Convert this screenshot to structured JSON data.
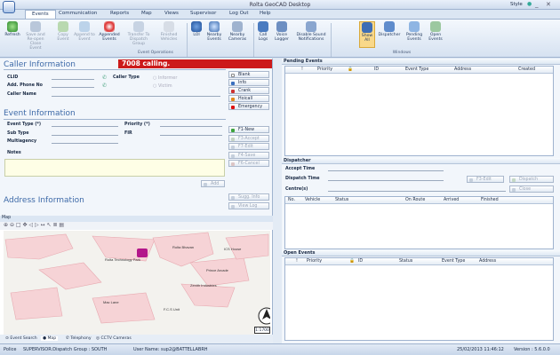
{
  "window": {
    "title": "Rolta GeoCAD Desktop",
    "style_label": "Style",
    "min": "_",
    "close": "✕"
  },
  "menu": [
    "Events",
    "Communication",
    "Reports",
    "Map",
    "Views",
    "Supervisor",
    "Log Out",
    "Help"
  ],
  "ribbon": {
    "buttons": [
      "Refresh",
      "Save and Re-open Close Event",
      "Copy Event",
      "Append to Event",
      "Appended Events",
      "Transfer To Dispatch Group",
      "Finished Vehicles",
      "LOI",
      "Nearby Events",
      "Nearby Cameras",
      "Call Logs",
      "Voice Logger",
      "Disable Sound Notifications",
      "Show All",
      "Dispatcher",
      "Pending Events",
      "Open Events"
    ],
    "groups": {
      "event_operations": "Event Operations",
      "windows": "Windows"
    }
  },
  "caller": {
    "heading": "Caller Information",
    "alert": "7008 calling.",
    "labels": {
      "clid": "CLID",
      "caller_type": "Caller Type",
      "add_phone": "Add. Phone No",
      "caller_name": "Caller Name"
    },
    "options": [
      "Informer",
      "Victim"
    ]
  },
  "actions": [
    "Blank",
    "Info",
    "Crank",
    "Hoicall",
    "Emergency"
  ],
  "event": {
    "heading": "Event Information",
    "labels": {
      "event_type": "Event Type (*)",
      "priority": "Priority (*)",
      "sub_type": "Sub Type",
      "fir": "FIR",
      "multiagency": "Multiagency",
      "notes": "Notes"
    },
    "add": "Add"
  },
  "fkeys": [
    "F1-New",
    "F3-Accept",
    "F7-Edit",
    "F4-Save",
    "F6-Cancel"
  ],
  "address": {
    "heading": "Address Information",
    "suggestions": "Sugg. Info",
    "view_log": "View Log"
  },
  "map": {
    "panel_title": "Map",
    "labels": [
      "Rolta Technology Park",
      "Rolta Bhavan",
      "ICS House",
      "Prince Arcade",
      "Zenith Industries",
      "Mac Lane",
      "F.C.S Unit"
    ],
    "scale": "1:1700",
    "tabs": [
      "Event Search",
      "Map",
      "Telephony",
      "CCTV Cameras"
    ]
  },
  "pending": {
    "title": "Pending Events",
    "columns": [
      "!",
      "Priority",
      "🔒",
      "ID",
      "Event Type",
      "Address",
      "Created"
    ]
  },
  "dispatcher": {
    "title": "Dispatcher",
    "labels": {
      "accept_time": "Accept Time",
      "dispatch_time": "Dispatch Time",
      "centre": "Centre(s)"
    },
    "buttons": [
      "F3-Edit",
      "Dispatch",
      "Close"
    ],
    "columns": [
      "No.",
      "Vehicle",
      "Status",
      "On Route",
      "Arrived",
      "Finished"
    ]
  },
  "open": {
    "title": "Open Events",
    "columns": [
      "!",
      "Priority",
      "🔒",
      "ID",
      "Status",
      "Event Type",
      "Address"
    ]
  },
  "status": {
    "role": "Police",
    "dispatch_group": "SUPERVISOR:Dispatch Group : SOUTH",
    "user": "User Name: sup2@BATTELLABRH",
    "datetime": "25/02/2013 11:46:12",
    "version": "Version : 5.6.0.0"
  },
  "colors": {
    "accent": "#3e6aa8",
    "alert": "#cc1a1a"
  }
}
